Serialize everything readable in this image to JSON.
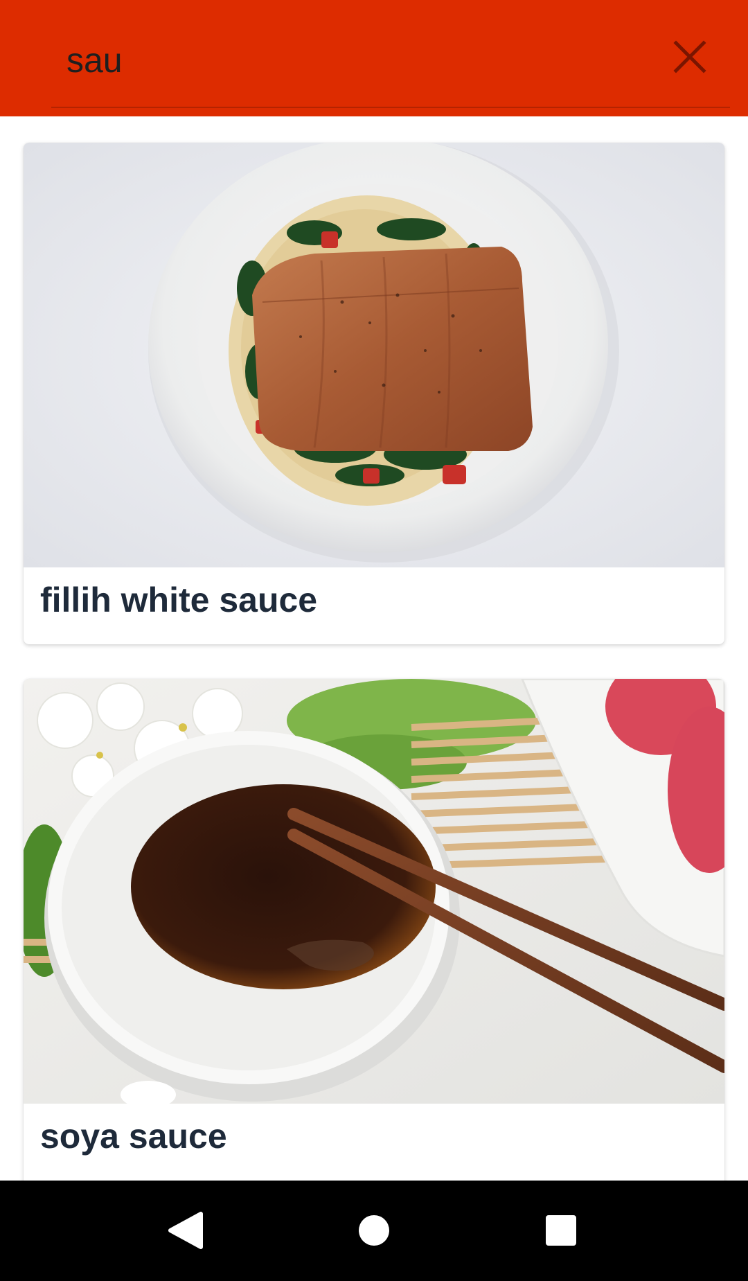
{
  "search": {
    "value": "sau",
    "placeholder": ""
  },
  "icons": {
    "clear": "close-icon",
    "back": "back-triangle-icon",
    "home": "home-circle-icon",
    "recents": "recents-square-icon"
  },
  "colors": {
    "search_bar": "#dd2c00",
    "title_text": "#1e2a3a",
    "nav_bar": "#000000"
  },
  "results": [
    {
      "title": "fillih white sauce",
      "image": "salmon-fillet-on-spinach-cream-sauce"
    },
    {
      "title": "soya sauce",
      "image": "soy-sauce-bowl-with-chopsticks"
    }
  ]
}
